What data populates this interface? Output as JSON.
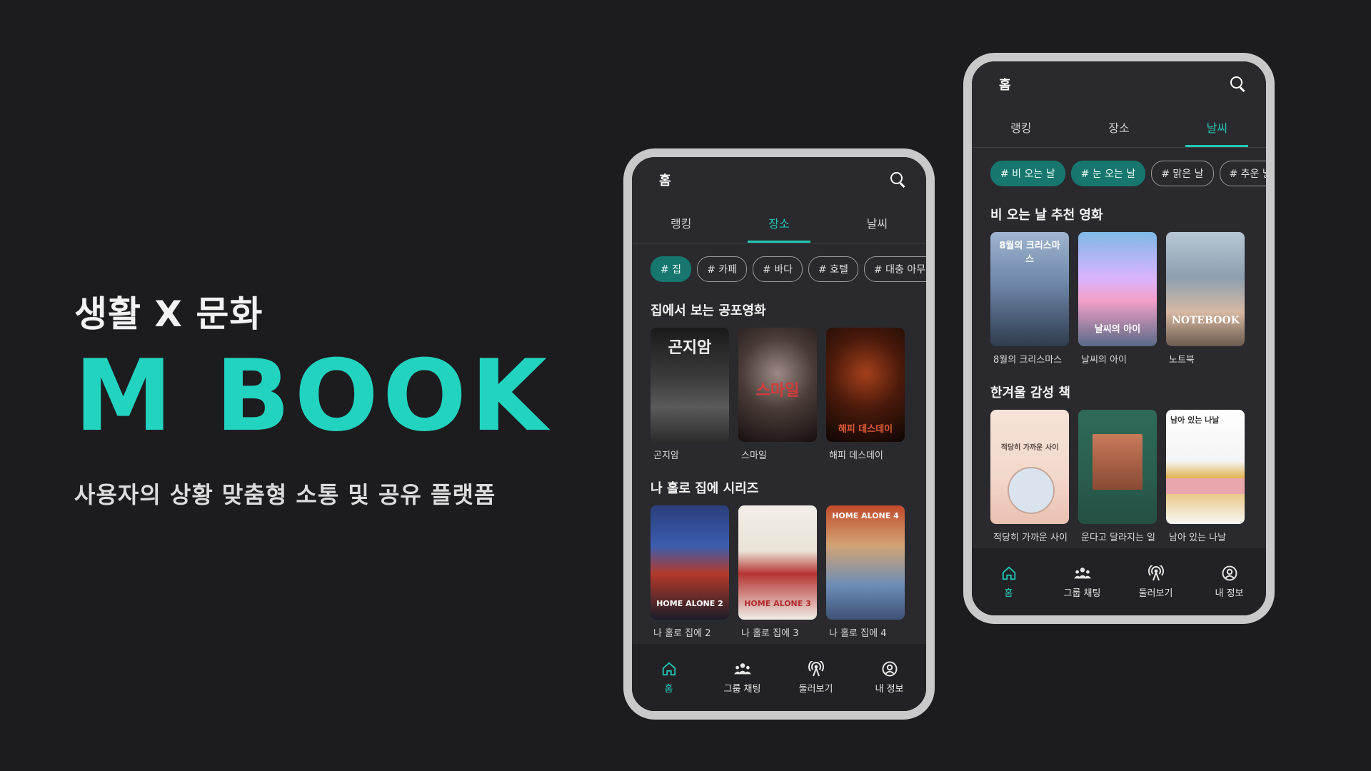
{
  "hero": {
    "tagline": "생활 X 문화",
    "brand": "M BOOK",
    "subtitle": "사용자의 상황 맞춤형 소통 및 공유 플랫폼"
  },
  "colors": {
    "accent": "#22c7b4",
    "background": "#1c1c1f",
    "phone_frame": "#c9c9c9"
  },
  "phone_left": {
    "title": "홈",
    "tabs": [
      "랭킹",
      "장소",
      "날씨"
    ],
    "active_tab": "장소",
    "chips": [
      "# 집",
      "# 카페",
      "# 바다",
      "# 호텔",
      "# 대충 아무 곳"
    ],
    "sections": [
      {
        "title": "집에서 보는 공포영화",
        "items": [
          {
            "caption": "곤지암",
            "poster_text": "곤지암",
            "icon": "poster-gonjiam"
          },
          {
            "caption": "스마일",
            "poster_text": "스마일",
            "icon": "poster-smile"
          },
          {
            "caption": "해피 데스데이",
            "poster_text": "해피 데스데이",
            "icon": "poster-happy-death-day"
          }
        ]
      },
      {
        "title": "나 홀로 집에 시리즈",
        "items": [
          {
            "caption": "나 홀로 집에 2",
            "poster_text": "HOME ALONE 2",
            "icon": "poster-home-alone-2"
          },
          {
            "caption": "나 홀로 집에 3",
            "poster_text": "HOME ALONE 3",
            "icon": "poster-home-alone-3"
          },
          {
            "caption": "나 홀로 집에 4",
            "poster_text": "HOME ALONE 4",
            "icon": "poster-home-alone-4"
          }
        ]
      }
    ],
    "nav": [
      {
        "label": "홈",
        "icon": "home-icon",
        "active": true
      },
      {
        "label": "그룹 채팅",
        "icon": "group-chat-icon",
        "active": false
      },
      {
        "label": "둘러보기",
        "icon": "broadcast-icon",
        "active": false
      },
      {
        "label": "내 정보",
        "icon": "profile-icon",
        "active": false
      }
    ]
  },
  "phone_right": {
    "title": "홈",
    "tabs": [
      "랭킹",
      "장소",
      "날씨"
    ],
    "active_tab": "날씨",
    "chips": [
      "# 비 오는 날",
      "# 눈 오는 날",
      "# 맑은 날",
      "# 추운 날"
    ],
    "sections": [
      {
        "title": "비 오는 날 추천 영화",
        "items": [
          {
            "caption": "8월의 크리스마스",
            "poster_text": "8월의 크리스마스",
            "icon": "poster-august-christmas"
          },
          {
            "caption": "날씨의 아이",
            "poster_text": "날씨의 아이",
            "icon": "poster-weathering-with-you"
          },
          {
            "caption": "노트북",
            "poster_text": "NOTEBOOK",
            "icon": "poster-notebook"
          }
        ]
      },
      {
        "title": "한겨울 감성 책",
        "items": [
          {
            "caption": "적당히 가까운 사이",
            "poster_text": "적당히 가까운 사이",
            "icon": "book-cover-1"
          },
          {
            "caption": "운다고 달라지는 일",
            "poster_text": "",
            "icon": "book-cover-2"
          },
          {
            "caption": "남아 있는 나날",
            "poster_text": "남아 있는 나날",
            "icon": "book-cover-3"
          }
        ]
      }
    ],
    "nav": [
      {
        "label": "홈",
        "icon": "home-icon",
        "active": true
      },
      {
        "label": "그룹 채팅",
        "icon": "group-chat-icon",
        "active": false
      },
      {
        "label": "둘러보기",
        "icon": "broadcast-icon",
        "active": false
      },
      {
        "label": "내 정보",
        "icon": "profile-icon",
        "active": false
      }
    ]
  }
}
